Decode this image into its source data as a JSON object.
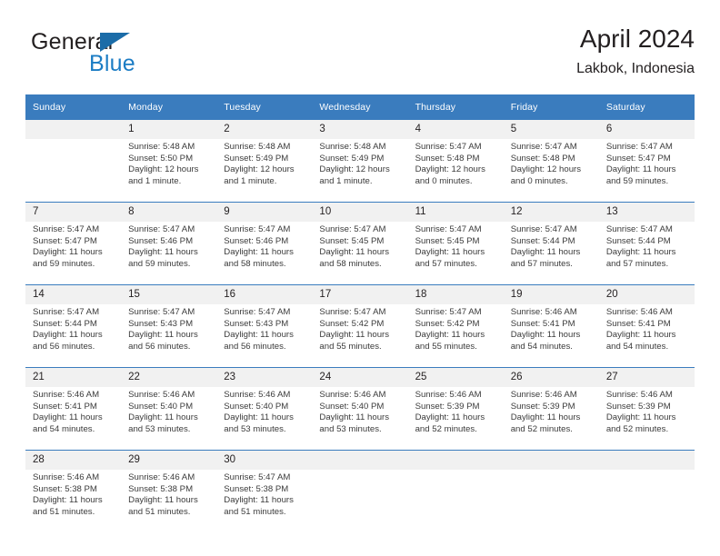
{
  "brand": {
    "name_part1": "General",
    "name_part2": "Blue"
  },
  "header": {
    "title": "April 2024",
    "subtitle": "Lakbok, Indonesia"
  },
  "colors": {
    "header_blue": "#3a7cbe",
    "logo_blue": "#1b7cc4",
    "daynum_band": "#f1f1f1",
    "text": "#231f20"
  },
  "weekday_headers": [
    "Sunday",
    "Monday",
    "Tuesday",
    "Wednesday",
    "Thursday",
    "Friday",
    "Saturday"
  ],
  "weeks": [
    [
      {
        "day": "",
        "sunrise": "",
        "sunset": "",
        "daylight": "",
        "empty": true
      },
      {
        "day": "1",
        "sunrise": "Sunrise: 5:48 AM",
        "sunset": "Sunset: 5:50 PM",
        "daylight": "Daylight: 12 hours and 1 minute."
      },
      {
        "day": "2",
        "sunrise": "Sunrise: 5:48 AM",
        "sunset": "Sunset: 5:49 PM",
        "daylight": "Daylight: 12 hours and 1 minute."
      },
      {
        "day": "3",
        "sunrise": "Sunrise: 5:48 AM",
        "sunset": "Sunset: 5:49 PM",
        "daylight": "Daylight: 12 hours and 1 minute."
      },
      {
        "day": "4",
        "sunrise": "Sunrise: 5:47 AM",
        "sunset": "Sunset: 5:48 PM",
        "daylight": "Daylight: 12 hours and 0 minutes."
      },
      {
        "day": "5",
        "sunrise": "Sunrise: 5:47 AM",
        "sunset": "Sunset: 5:48 PM",
        "daylight": "Daylight: 12 hours and 0 minutes."
      },
      {
        "day": "6",
        "sunrise": "Sunrise: 5:47 AM",
        "sunset": "Sunset: 5:47 PM",
        "daylight": "Daylight: 11 hours and 59 minutes."
      }
    ],
    [
      {
        "day": "7",
        "sunrise": "Sunrise: 5:47 AM",
        "sunset": "Sunset: 5:47 PM",
        "daylight": "Daylight: 11 hours and 59 minutes."
      },
      {
        "day": "8",
        "sunrise": "Sunrise: 5:47 AM",
        "sunset": "Sunset: 5:46 PM",
        "daylight": "Daylight: 11 hours and 59 minutes."
      },
      {
        "day": "9",
        "sunrise": "Sunrise: 5:47 AM",
        "sunset": "Sunset: 5:46 PM",
        "daylight": "Daylight: 11 hours and 58 minutes."
      },
      {
        "day": "10",
        "sunrise": "Sunrise: 5:47 AM",
        "sunset": "Sunset: 5:45 PM",
        "daylight": "Daylight: 11 hours and 58 minutes."
      },
      {
        "day": "11",
        "sunrise": "Sunrise: 5:47 AM",
        "sunset": "Sunset: 5:45 PM",
        "daylight": "Daylight: 11 hours and 57 minutes."
      },
      {
        "day": "12",
        "sunrise": "Sunrise: 5:47 AM",
        "sunset": "Sunset: 5:44 PM",
        "daylight": "Daylight: 11 hours and 57 minutes."
      },
      {
        "day": "13",
        "sunrise": "Sunrise: 5:47 AM",
        "sunset": "Sunset: 5:44 PM",
        "daylight": "Daylight: 11 hours and 57 minutes."
      }
    ],
    [
      {
        "day": "14",
        "sunrise": "Sunrise: 5:47 AM",
        "sunset": "Sunset: 5:44 PM",
        "daylight": "Daylight: 11 hours and 56 minutes."
      },
      {
        "day": "15",
        "sunrise": "Sunrise: 5:47 AM",
        "sunset": "Sunset: 5:43 PM",
        "daylight": "Daylight: 11 hours and 56 minutes."
      },
      {
        "day": "16",
        "sunrise": "Sunrise: 5:47 AM",
        "sunset": "Sunset: 5:43 PM",
        "daylight": "Daylight: 11 hours and 56 minutes."
      },
      {
        "day": "17",
        "sunrise": "Sunrise: 5:47 AM",
        "sunset": "Sunset: 5:42 PM",
        "daylight": "Daylight: 11 hours and 55 minutes."
      },
      {
        "day": "18",
        "sunrise": "Sunrise: 5:47 AM",
        "sunset": "Sunset: 5:42 PM",
        "daylight": "Daylight: 11 hours and 55 minutes."
      },
      {
        "day": "19",
        "sunrise": "Sunrise: 5:46 AM",
        "sunset": "Sunset: 5:41 PM",
        "daylight": "Daylight: 11 hours and 54 minutes."
      },
      {
        "day": "20",
        "sunrise": "Sunrise: 5:46 AM",
        "sunset": "Sunset: 5:41 PM",
        "daylight": "Daylight: 11 hours and 54 minutes."
      }
    ],
    [
      {
        "day": "21",
        "sunrise": "Sunrise: 5:46 AM",
        "sunset": "Sunset: 5:41 PM",
        "daylight": "Daylight: 11 hours and 54 minutes."
      },
      {
        "day": "22",
        "sunrise": "Sunrise: 5:46 AM",
        "sunset": "Sunset: 5:40 PM",
        "daylight": "Daylight: 11 hours and 53 minutes."
      },
      {
        "day": "23",
        "sunrise": "Sunrise: 5:46 AM",
        "sunset": "Sunset: 5:40 PM",
        "daylight": "Daylight: 11 hours and 53 minutes."
      },
      {
        "day": "24",
        "sunrise": "Sunrise: 5:46 AM",
        "sunset": "Sunset: 5:40 PM",
        "daylight": "Daylight: 11 hours and 53 minutes."
      },
      {
        "day": "25",
        "sunrise": "Sunrise: 5:46 AM",
        "sunset": "Sunset: 5:39 PM",
        "daylight": "Daylight: 11 hours and 52 minutes."
      },
      {
        "day": "26",
        "sunrise": "Sunrise: 5:46 AM",
        "sunset": "Sunset: 5:39 PM",
        "daylight": "Daylight: 11 hours and 52 minutes."
      },
      {
        "day": "27",
        "sunrise": "Sunrise: 5:46 AM",
        "sunset": "Sunset: 5:39 PM",
        "daylight": "Daylight: 11 hours and 52 minutes."
      }
    ],
    [
      {
        "day": "28",
        "sunrise": "Sunrise: 5:46 AM",
        "sunset": "Sunset: 5:38 PM",
        "daylight": "Daylight: 11 hours and 51 minutes."
      },
      {
        "day": "29",
        "sunrise": "Sunrise: 5:46 AM",
        "sunset": "Sunset: 5:38 PM",
        "daylight": "Daylight: 11 hours and 51 minutes."
      },
      {
        "day": "30",
        "sunrise": "Sunrise: 5:47 AM",
        "sunset": "Sunset: 5:38 PM",
        "daylight": "Daylight: 11 hours and 51 minutes."
      },
      {
        "day": "",
        "sunrise": "",
        "sunset": "",
        "daylight": "",
        "empty": true
      },
      {
        "day": "",
        "sunrise": "",
        "sunset": "",
        "daylight": "",
        "empty": true
      },
      {
        "day": "",
        "sunrise": "",
        "sunset": "",
        "daylight": "",
        "empty": true
      },
      {
        "day": "",
        "sunrise": "",
        "sunset": "",
        "daylight": "",
        "empty": true
      }
    ]
  ]
}
